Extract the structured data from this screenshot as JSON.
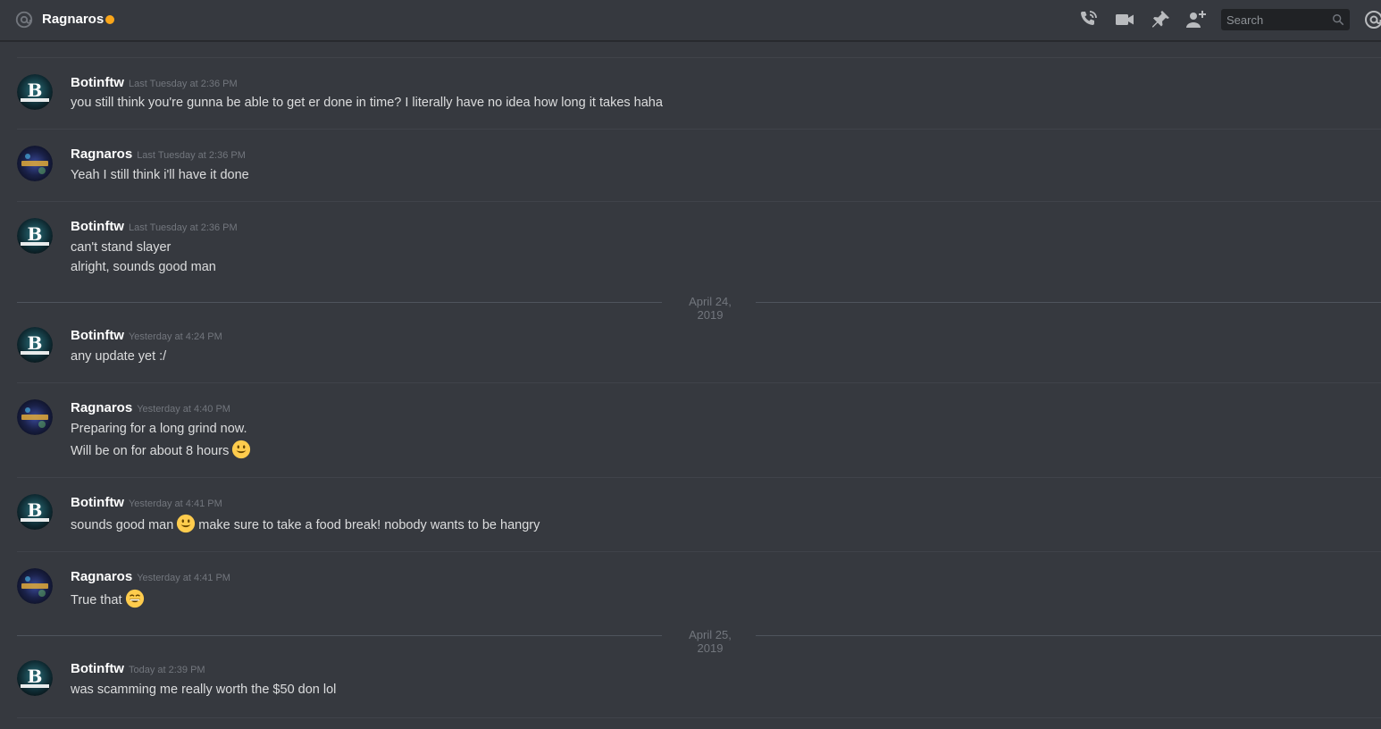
{
  "header": {
    "title": "Ragnaros",
    "status_color": "#faa61a",
    "search_placeholder": "Search",
    "icons": [
      "at-icon",
      "call-icon",
      "video-icon",
      "pin-icon",
      "add-friend-icon",
      "search-icon",
      "mention-icon"
    ]
  },
  "date_separators": [
    "April 24, 2019",
    "April 25, 2019"
  ],
  "messages": [
    {
      "user": "Botinftw",
      "time": "Last Tuesday at 2:36 PM",
      "lines": [
        "you still think you're gunna be able to get er done in time? I literally have no idea how long it takes haha"
      ]
    },
    {
      "user": "Ragnaros",
      "time": "Last Tuesday at 2:36 PM",
      "lines": [
        "Yeah I still think i'll have it done"
      ]
    },
    {
      "user": "Botinftw",
      "time": "Last Tuesday at 2:36 PM",
      "lines": [
        "can't stand slayer",
        "alright, sounds good man"
      ]
    },
    {
      "user": "Botinftw",
      "time": "Yesterday at 4:24 PM",
      "lines": [
        "any update yet :/"
      ]
    },
    {
      "user": "Ragnaros",
      "time": "Yesterday at 4:40 PM",
      "lines": [
        "Preparing for a long grind now.",
        "Will be on for about 8 hours"
      ]
    },
    {
      "user": "Botinftw",
      "time": "Yesterday at 4:41 PM",
      "lines": [
        "sounds good man",
        "make sure to take a food break! nobody wants to be hangry"
      ]
    },
    {
      "user": "Ragnaros",
      "time": "Yesterday at 4:41 PM",
      "lines": [
        "True that"
      ]
    },
    {
      "user": "Botinftw",
      "time": "Today at 2:39 PM",
      "lines": [
        "was scamming me really worth the $50 don lol"
      ]
    }
  ]
}
